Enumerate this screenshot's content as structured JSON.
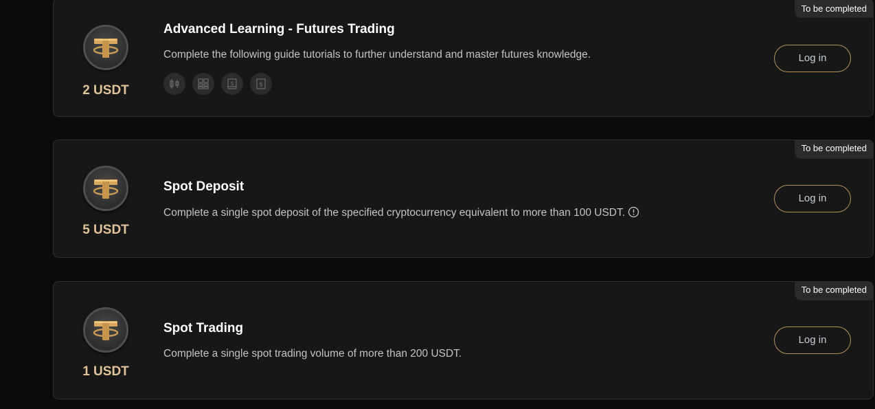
{
  "tasks": [
    {
      "status": "To be completed",
      "reward": "2 USDT",
      "title": "Advanced Learning - Futures Trading",
      "description": "Complete the following guide tutorials to further understand and master futures knowledge.",
      "action_label": "Log in",
      "guide_icons": [
        "candlestick-chart-icon",
        "grid-layout-icon",
        "book-dollar-icon",
        "document-dollar-icon"
      ]
    },
    {
      "status": "To be completed",
      "reward": "5 USDT",
      "title": "Spot Deposit",
      "description": "Complete a single spot deposit of the specified cryptocurrency equivalent to more than 100 USDT.",
      "action_label": "Log in",
      "info_icon": "info-icon"
    },
    {
      "status": "To be completed",
      "reward": "1 USDT",
      "title": "Spot Trading",
      "description": "Complete a single spot trading volume of more than 200 USDT.",
      "action_label": "Log in"
    }
  ],
  "colors": {
    "background": "#0b0b0b",
    "card": "#171717",
    "accent_gold": "#e1c39a",
    "button_border": "#b8925a"
  }
}
